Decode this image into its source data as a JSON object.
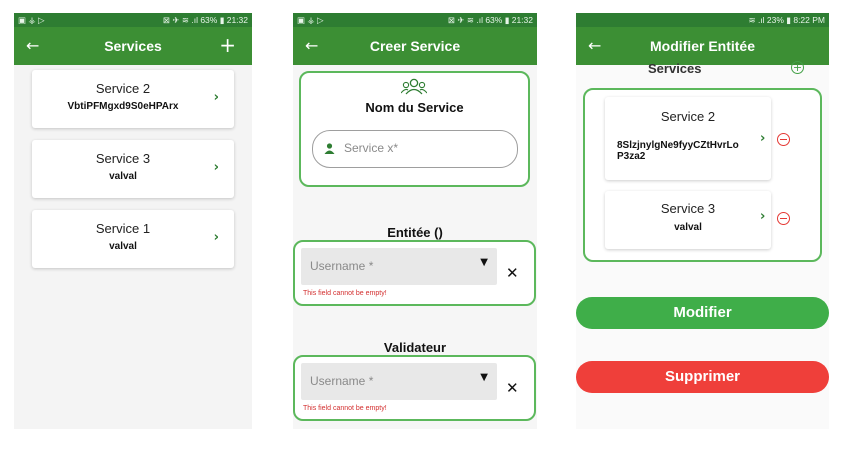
{
  "colors": {
    "primary": "#3c8f34",
    "accent_border": "#5cb85c",
    "danger": "#ef3f3a",
    "success_button": "#3fae49"
  },
  "screen1": {
    "status_left": "▣ ⚶ ▷",
    "status_right": "⊠ ✈ ≋ .ıl 63% ▮ 21:32",
    "title": "Services",
    "back_icon": "←",
    "add_icon": "+",
    "services": [
      {
        "name": "Service 2",
        "detail": "VbtiPFMgxd9S0eHPArx"
      },
      {
        "name": "Service 3",
        "detail": "valval"
      },
      {
        "name": "Service 1",
        "detail": "valval"
      }
    ]
  },
  "screen2": {
    "status_left": "▣ ⚶ ▷",
    "status_right": "⊠ ✈ ≋ .ıl 63% ▮ 21:32",
    "title": "Creer Service",
    "back_icon": "←",
    "service_heading": "Nom du Service",
    "service_placeholder": "Service x*",
    "entity_heading": "Entitée ()",
    "validator_heading": "Validateur",
    "dropdown_placeholder": "Username *",
    "error_text": "This field cannot be empty!",
    "clear_icon": "✕"
  },
  "screen3": {
    "status_right": "≋ .ıl 23% ▮ 8:22 PM",
    "title": "Modifier Entitée",
    "back_icon": "←",
    "services_label": "Services",
    "services": [
      {
        "name": "Service 2",
        "detail": "8SlzjnylgNe9fyyCZtHvrLo P3za2"
      },
      {
        "name": "Service 3",
        "detail": "valval"
      }
    ],
    "modify_label": "Modifier",
    "delete_label": "Supprimer"
  }
}
